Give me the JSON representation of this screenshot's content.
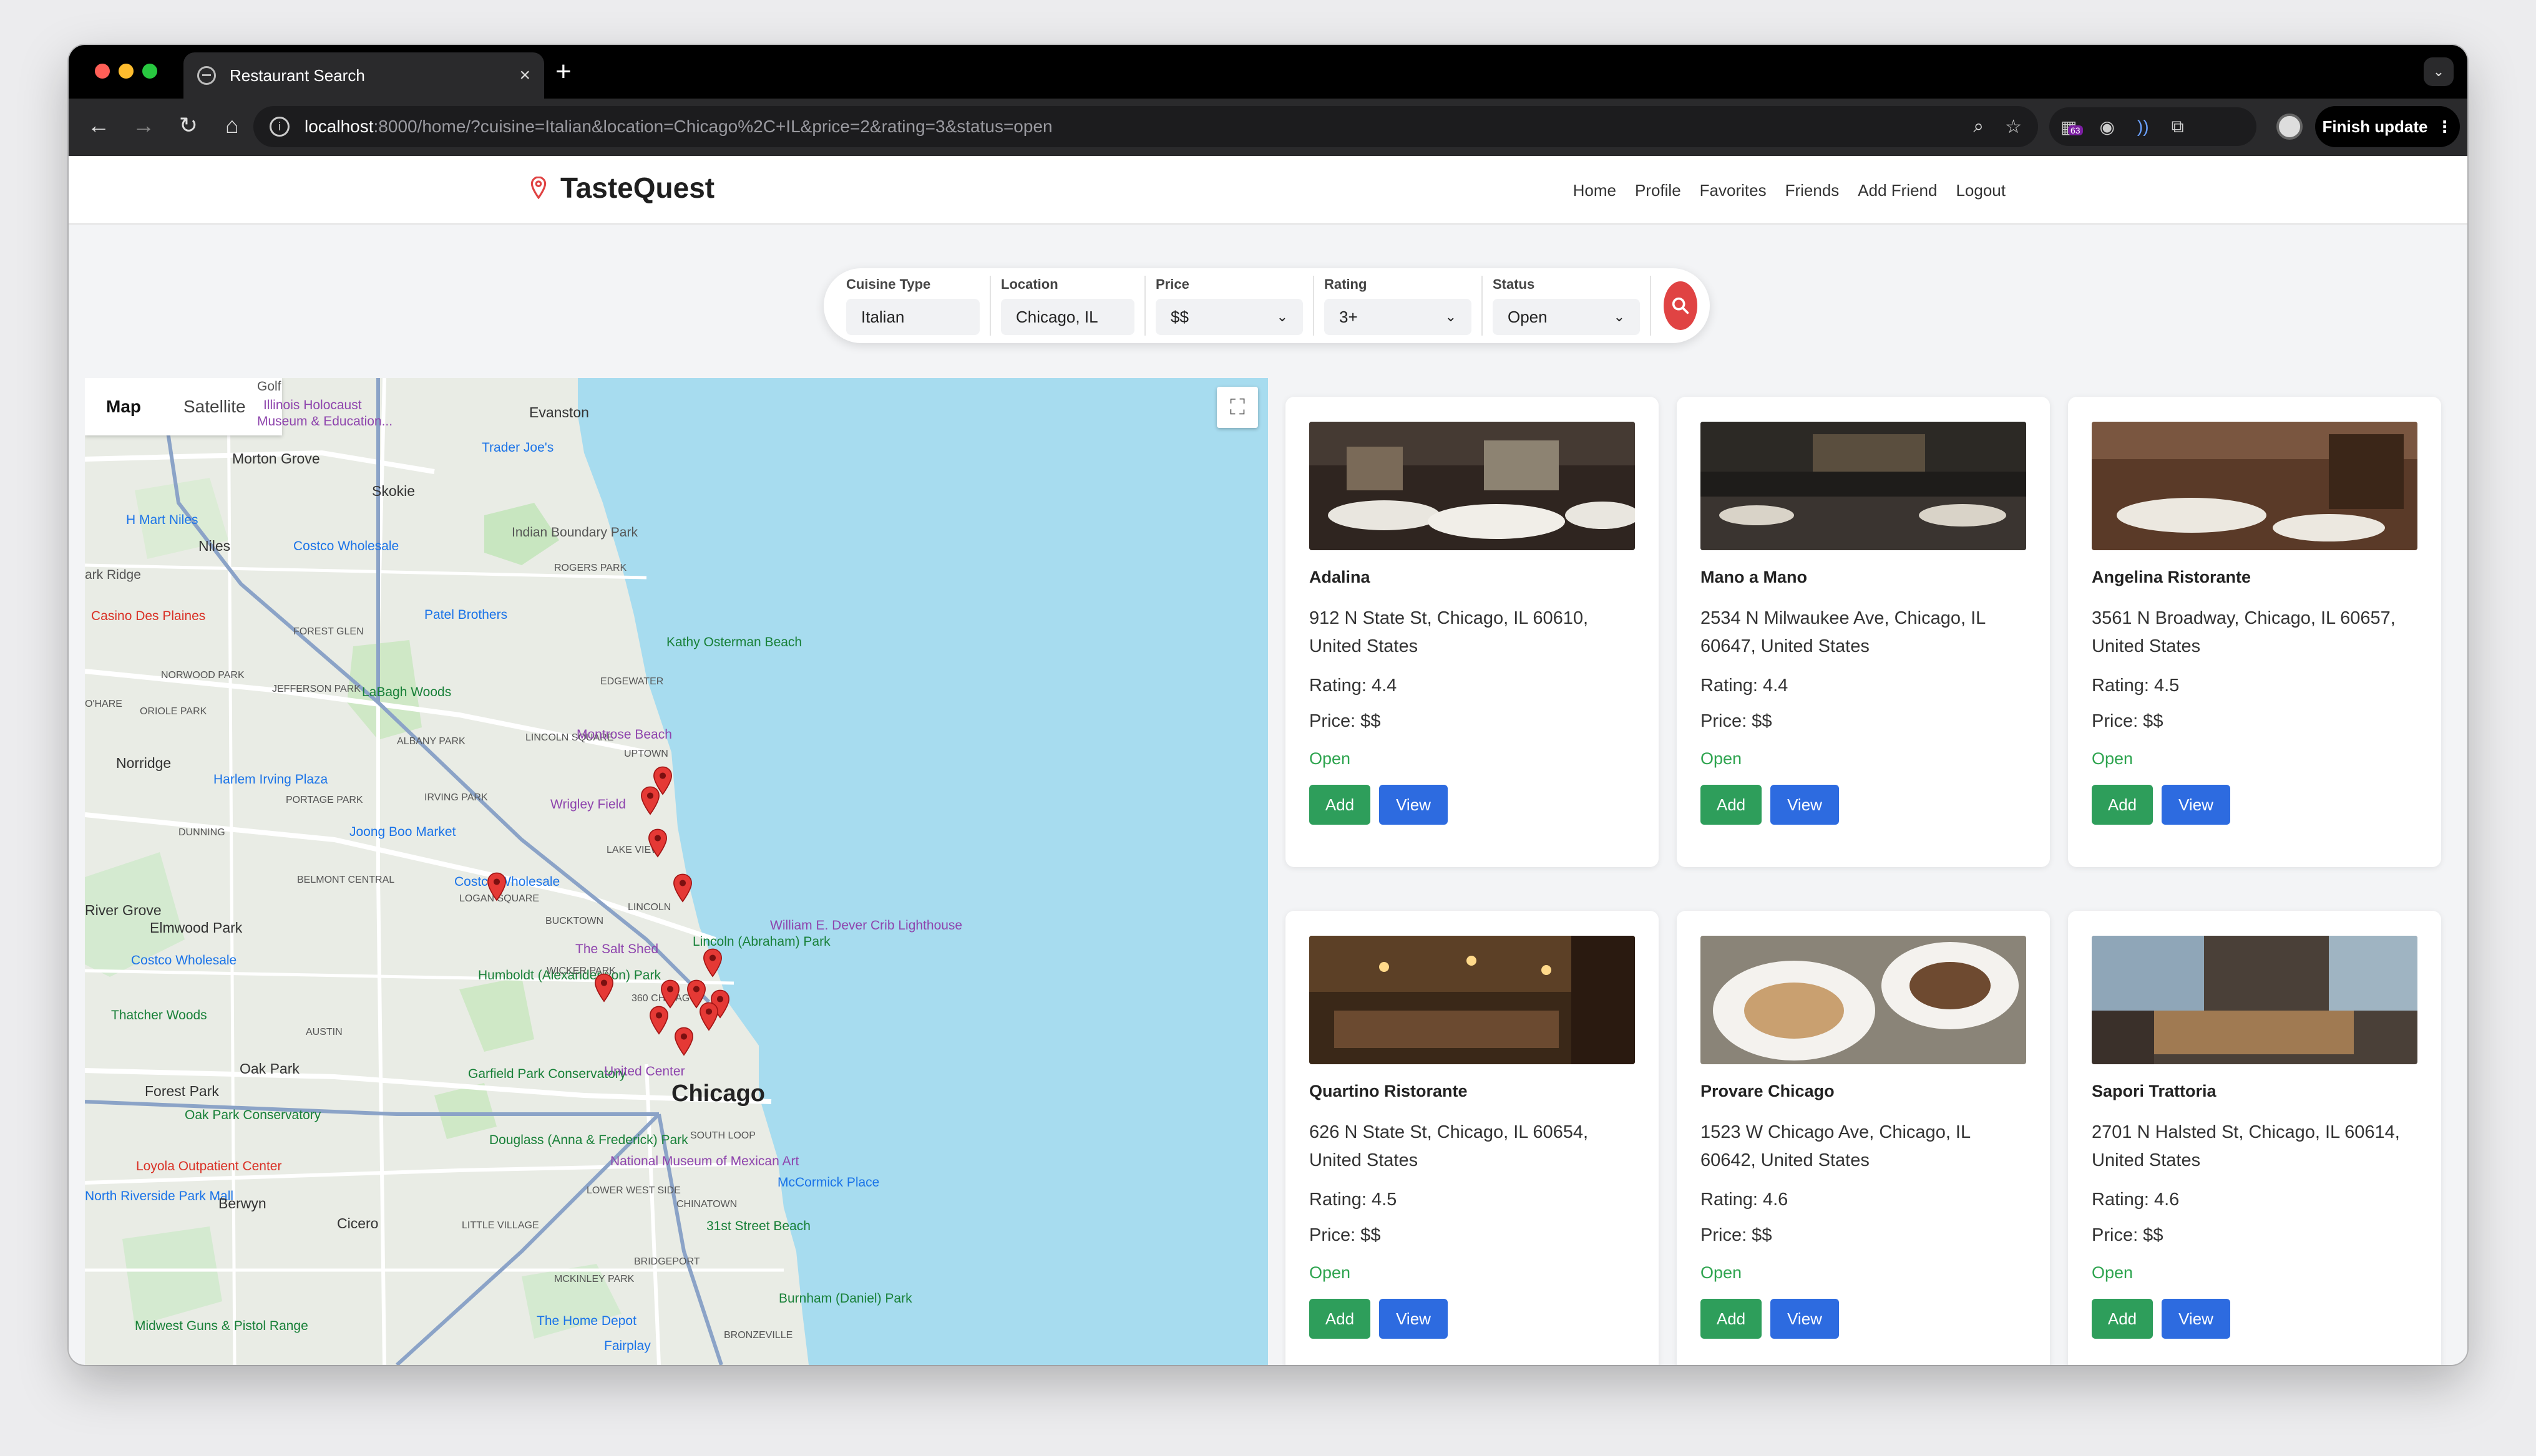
{
  "browser": {
    "tab_title": "Restaurant Search",
    "tab_close": "×",
    "new_tab": "+",
    "url_host": "localhost",
    "url_rest": ":8000/home/?cuisine=Italian&location=Chicago%2C+IL&price=2&rating=3&status=open",
    "extension_badge": "63",
    "finish_update": "Finish update",
    "finish_update_menu": "⋮"
  },
  "site": {
    "brand": "TasteQuest",
    "nav": [
      "Home",
      "Profile",
      "Favorites",
      "Friends",
      "Add Friend",
      "Logout"
    ]
  },
  "filters": {
    "cuisine": {
      "label": "Cuisine Type",
      "value": "Italian"
    },
    "location": {
      "label": "Location",
      "value": "Chicago, IL"
    },
    "price": {
      "label": "Price",
      "value": "$$"
    },
    "rating": {
      "label": "Rating",
      "value": "3+"
    },
    "status": {
      "label": "Status",
      "value": "Open"
    }
  },
  "map": {
    "tabs": [
      "Map",
      "Satellite"
    ],
    "city_label": "Chicago",
    "labels": [
      "Golf",
      "Evanston",
      "Illinois Holocaust",
      "Museum & Education...",
      "Morton Grove",
      "Trader Joe's",
      "Skokie",
      "H Mart Niles",
      "Niles",
      "Costco Wholesale",
      "Indian Boundary Park",
      "ROGERS PARK",
      "ark Ridge",
      "Casino Des Plaines",
      "Patel Brothers",
      "FOREST GLEN",
      "Kathy Osterman Beach",
      "NORWOOD PARK",
      "EDGEWATER",
      "O'HARE",
      "ORIOLE PARK",
      "JEFFERSON PARK",
      "LaBagh Woods",
      "ALBANY PARK",
      "LINCOLN SQUARE",
      "Montrose Beach",
      "UPTOWN",
      "Norridge",
      "Harlem Irving Plaza",
      "PORTAGE PARK",
      "IRVING PARK",
      "Wrigley Field",
      "DUNNING",
      "Joong Boo Market",
      "LAKE VIEW",
      "BELMONT CENTRAL",
      "Costco Wholesale",
      "LOGAN SQUARE",
      "LINCOLN",
      "River Grove",
      "Elmwood Park",
      "BUCKTOWN",
      "William E. Dever Crib Lighthouse",
      "The Salt Shed",
      "Lincoln (Abraham) Park",
      "Costco Wholesale",
      "Humboldt (Alexander von) Park",
      "WICKER PARK",
      "Thatcher Woods",
      "360 CHICAGO",
      "AUSTIN",
      "Garfield Park Conservatory",
      "United Center",
      "Oak Park",
      "Forest Park",
      "Oak Park Conservatory",
      "SOUTH LOOP",
      "Loyola Outpatient Center",
      "Douglass (Anna & Frederick) Park",
      "National Museum of Mexican Art",
      "McCormick Place",
      "North Riverside Park Mall",
      "Berwyn",
      "LOWER WEST SIDE",
      "CHINATOWN",
      "Cicero",
      "LITTLE VILLAGE",
      "31st Street Beach",
      "BRIDGEPORT",
      "MCKINLEY PARK",
      "Burnham (Daniel) Park",
      "Midwest Guns & Pistol Range",
      "The Home Depot",
      "Fairplay",
      "BRONZEVILLE"
    ],
    "marker_count": 13
  },
  "restaurants": [
    {
      "name": "Adalina",
      "address": "912 N State St, Chicago, IL 60610, United States",
      "rating": "Rating: 4.4",
      "price": "Price: $$",
      "status": "Open",
      "add": "Add",
      "view": "View"
    },
    {
      "name": "Mano a Mano",
      "address": "2534 N Milwaukee Ave, Chicago, IL 60647, United States",
      "rating": "Rating: 4.4",
      "price": "Price: $$",
      "status": "Open",
      "add": "Add",
      "view": "View"
    },
    {
      "name": "Angelina Ristorante",
      "address": "3561 N Broadway, Chicago, IL 60657, United States",
      "rating": "Rating: 4.5",
      "price": "Price: $$",
      "status": "Open",
      "add": "Add",
      "view": "View"
    },
    {
      "name": "Quartino Ristorante",
      "address": "626 N State St, Chicago, IL 60654, United States",
      "rating": "Rating: 4.5",
      "price": "Price: $$",
      "status": "Open",
      "add": "Add",
      "view": "View"
    },
    {
      "name": "Provare Chicago",
      "address": "1523 W Chicago Ave, Chicago, IL 60642, United States",
      "rating": "Rating: 4.6",
      "price": "Price: $$",
      "status": "Open",
      "add": "Add",
      "view": "View"
    },
    {
      "name": "Sapori Trattoria",
      "address": "2701 N Halsted St, Chicago, IL 60614, United States",
      "rating": "Rating: 4.6",
      "price": "Price: $$",
      "status": "Open",
      "add": "Add",
      "view": "View"
    }
  ],
  "colors": {
    "add_button": "#2e9e5b",
    "view_button": "#2d6be0",
    "open_status": "#2ea44f",
    "search_button": "#e04343",
    "brand_pin": "#e04343",
    "lake": "#a7dcef"
  }
}
